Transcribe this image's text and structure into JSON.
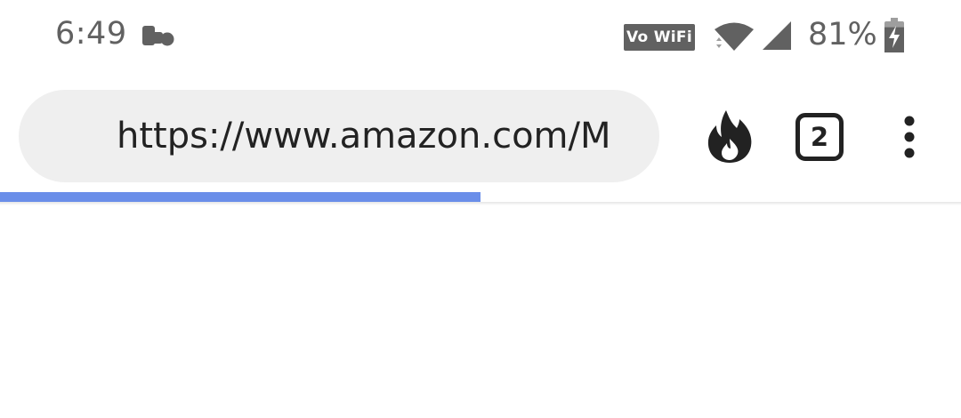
{
  "status_bar": {
    "time": "6:49",
    "network_badge": "Vo WiFi",
    "battery_percent": "81%",
    "battery_level": 0.81,
    "icons": [
      "notification-icon",
      "wifi-icon",
      "cellular-signal-icon",
      "battery-charging-icon"
    ]
  },
  "toolbar": {
    "url": "https://www.amazon.com/M",
    "tab_count": "2",
    "icons": [
      "fire-icon",
      "tabs-icon",
      "more-vert-icon"
    ]
  },
  "progress": {
    "value": 0.5,
    "color": "#6a8ee9"
  },
  "colors": {
    "status_gray": "#616161",
    "url_bar_bg": "#efefef",
    "icon_dark": "#222222"
  }
}
